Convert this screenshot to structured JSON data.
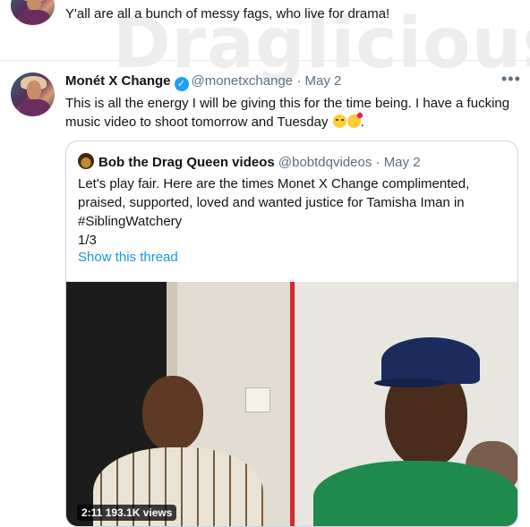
{
  "top_tweet": {
    "text": "Y'all are all a bunch of messy fags, who live for drama!"
  },
  "watermark": {
    "text": "Draglicious"
  },
  "tweet": {
    "author_name": "Monét X Change",
    "handle": "@monetxchange",
    "separator": "·",
    "date": "May 2",
    "more_icon": "ellipsis-icon",
    "text": "This is all the energy I will be giving this for the time being. I have a fucking music video to shoot tomorrow and Tuesday",
    "emoji": [
      "face-with-rolling-eyes",
      "face-blowing-a-kiss"
    ],
    "text_end": "."
  },
  "quoted_tweet": {
    "author_name": "Bob the Drag Queen videos",
    "handle": "@bobtdqvideos",
    "separator": "·",
    "date": "May 2",
    "text_line1": "Let's play fair. Here are the times Monet X Change complimented,",
    "text_line2": "praised, supported, loved and wanted justice for Tamisha Iman in",
    "text_line3": "#SiblingWatchery",
    "text_line4": "1/3",
    "show_thread_label": "Show this thread",
    "media": {
      "duration": "2:11",
      "views": "193.1K views",
      "divider_color": "#d9292a"
    }
  },
  "colors": {
    "link": "#1b95e0",
    "muted": "#5b7083",
    "verified": "#1da1f2",
    "border": "#ccd6dd"
  }
}
